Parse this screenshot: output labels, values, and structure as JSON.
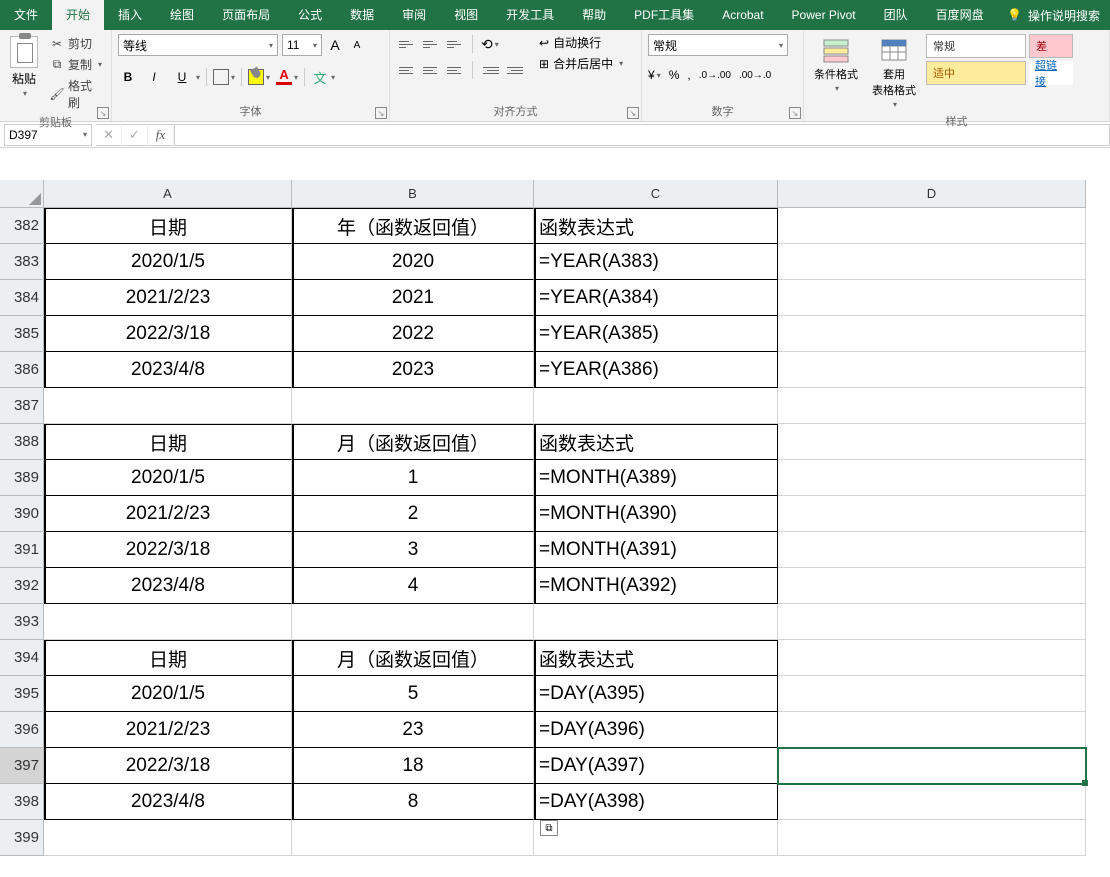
{
  "tabs": [
    "文件",
    "开始",
    "插入",
    "绘图",
    "页面布局",
    "公式",
    "数据",
    "审阅",
    "视图",
    "开发工具",
    "帮助",
    "PDF工具集",
    "Acrobat",
    "Power Pivot",
    "团队",
    "百度网盘"
  ],
  "active_tab_index": 1,
  "search_hint": "操作说明搜索",
  "clipboard": {
    "paste": "粘贴",
    "cut": "剪切",
    "copy": "复制",
    "fmt": "格式刷",
    "label": "剪贴板"
  },
  "font": {
    "name": "等线",
    "size": "11",
    "label": "字体",
    "bold": "B",
    "italic": "I",
    "underline": "U",
    "pinyin": "文",
    "A_big": "A",
    "A_small": "A",
    "Acolor": "A"
  },
  "align": {
    "label": "对齐方式",
    "wrap": "自动换行",
    "merge": "合并后居中"
  },
  "number": {
    "fmt": "常规",
    "label": "数字"
  },
  "styles": {
    "cond": "条件格式",
    "table": "套用\n表格格式",
    "normal": "常规",
    "bad": "差",
    "neutral": "适中",
    "link": "超链接",
    "label": "样式"
  },
  "name_box": "D397",
  "columns": [
    "A",
    "B",
    "C",
    "D"
  ],
  "rows": [
    {
      "n": 382,
      "a": "日期",
      "b": "年（函数返回值）",
      "c": "函数表达式",
      "d": "",
      "hdr": true
    },
    {
      "n": 383,
      "a": "2020/1/5",
      "b": "2020",
      "c": "=YEAR(A383)",
      "d": ""
    },
    {
      "n": 384,
      "a": "2021/2/23",
      "b": "2021",
      "c": "=YEAR(A384)",
      "d": ""
    },
    {
      "n": 385,
      "a": "2022/3/18",
      "b": "2022",
      "c": "=YEAR(A385)",
      "d": ""
    },
    {
      "n": 386,
      "a": "2023/4/8",
      "b": "2023",
      "c": "=YEAR(A386)",
      "d": "",
      "last": true
    },
    {
      "n": 387,
      "a": "",
      "b": "",
      "c": "",
      "d": "",
      "blank": true
    },
    {
      "n": 388,
      "a": "日期",
      "b": "月（函数返回值）",
      "c": "函数表达式",
      "d": "",
      "hdr": true
    },
    {
      "n": 389,
      "a": "2020/1/5",
      "b": "1",
      "c": "=MONTH(A389)",
      "d": ""
    },
    {
      "n": 390,
      "a": "2021/2/23",
      "b": "2",
      "c": "=MONTH(A390)",
      "d": ""
    },
    {
      "n": 391,
      "a": "2022/3/18",
      "b": "3",
      "c": "=MONTH(A391)",
      "d": ""
    },
    {
      "n": 392,
      "a": "2023/4/8",
      "b": "4",
      "c": "=MONTH(A392)",
      "d": "",
      "last": true
    },
    {
      "n": 393,
      "a": "",
      "b": "",
      "c": "",
      "d": "",
      "blank": true
    },
    {
      "n": 394,
      "a": "日期",
      "b": "月（函数返回值）",
      "c": "函数表达式",
      "d": "",
      "hdr": true
    },
    {
      "n": 395,
      "a": "2020/1/5",
      "b": "5",
      "c": "=DAY(A395)",
      "d": ""
    },
    {
      "n": 396,
      "a": "2021/2/23",
      "b": "23",
      "c": "=DAY(A396)",
      "d": ""
    },
    {
      "n": 397,
      "a": "2022/3/18",
      "b": "18",
      "c": "=DAY(A397)",
      "d": "",
      "active": true
    },
    {
      "n": 398,
      "a": "2023/4/8",
      "b": "8",
      "c": "=DAY(A398)",
      "d": "",
      "last": true
    },
    {
      "n": 399,
      "a": "",
      "b": "",
      "c": "",
      "d": "",
      "blank": true
    }
  ]
}
